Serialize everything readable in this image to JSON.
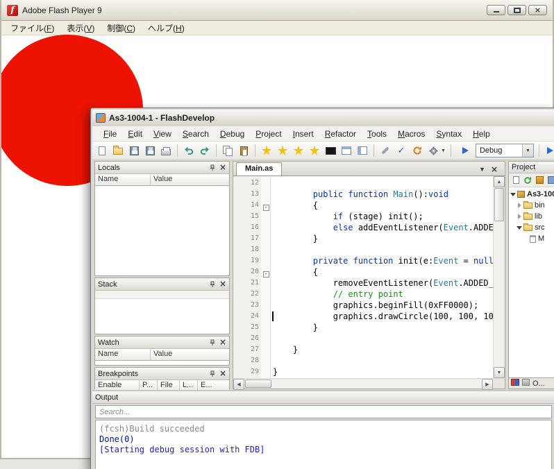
{
  "flash_player": {
    "title": "Adobe Flash Player 9",
    "menus": [
      "ファイル(F)",
      "表示(V)",
      "制御(C)",
      "ヘルプ(H)"
    ],
    "stage_circle_color": "#ED1300"
  },
  "fd": {
    "title": "As3-1004-1 - FlashDevelop",
    "menus": [
      "File",
      "Edit",
      "View",
      "Search",
      "Debug",
      "Project",
      "Insert",
      "Refactor",
      "Tools",
      "Macros",
      "Syntax",
      "Help"
    ],
    "toolbar": {
      "config_selected": "Debug"
    },
    "locals": {
      "title": "Locals",
      "columns": [
        "Name",
        "Value"
      ]
    },
    "stack": {
      "title": "Stack"
    },
    "watch": {
      "title": "Watch",
      "columns": [
        "Name",
        "Value"
      ]
    },
    "breakpoints": {
      "title": "Breakpoints",
      "columns": [
        "Enable",
        "P...",
        "File",
        "L...",
        "E..."
      ]
    },
    "editor": {
      "tab": "Main.as",
      "token_colors": {
        "k": "#0431c8",
        "t": "#1a7e99",
        "c": "#109310",
        "p": "#000000"
      },
      "lines": [
        {
          "n": 12,
          "segs": []
        },
        {
          "n": 13,
          "segs": [
            [
              "        ",
              "p"
            ],
            [
              "public",
              "k"
            ],
            [
              " ",
              "p"
            ],
            [
              "function",
              "k"
            ],
            [
              " ",
              "p"
            ],
            [
              "Main",
              "t"
            ],
            [
              "():",
              "p"
            ],
            [
              "void",
              "k"
            ]
          ]
        },
        {
          "n": 14,
          "fold": true,
          "segs": [
            [
              "        {",
              "p"
            ]
          ]
        },
        {
          "n": 15,
          "segs": [
            [
              "            ",
              "p"
            ],
            [
              "if",
              "k"
            ],
            [
              " (stage) init();",
              "p"
            ]
          ]
        },
        {
          "n": 16,
          "segs": [
            [
              "            ",
              "p"
            ],
            [
              "else",
              "k"
            ],
            [
              " addEventListener(",
              "p"
            ],
            [
              "Event",
              "t"
            ],
            [
              ".ADDE",
              "p"
            ]
          ]
        },
        {
          "n": 17,
          "segs": [
            [
              "        }",
              "p"
            ]
          ]
        },
        {
          "n": 18,
          "segs": []
        },
        {
          "n": 19,
          "segs": [
            [
              "        ",
              "p"
            ],
            [
              "private",
              "k"
            ],
            [
              " ",
              "p"
            ],
            [
              "function",
              "k"
            ],
            [
              " init(e:",
              "p"
            ],
            [
              "Event",
              "t"
            ],
            [
              " = ",
              "p"
            ],
            [
              "null",
              "k"
            ]
          ]
        },
        {
          "n": 20,
          "fold": true,
          "segs": [
            [
              "        {",
              "p"
            ]
          ]
        },
        {
          "n": 21,
          "segs": [
            [
              "            removeEventListener(",
              "p"
            ],
            [
              "Event",
              "t"
            ],
            [
              ".ADDED_",
              "p"
            ]
          ]
        },
        {
          "n": 22,
          "segs": [
            [
              "            ",
              "p"
            ],
            [
              "// entry point",
              "c"
            ]
          ]
        },
        {
          "n": 23,
          "segs": [
            [
              "            graphics.beginFill(0xFF0000);",
              "p"
            ]
          ]
        },
        {
          "n": 24,
          "caret": true,
          "segs": [
            [
              "            graphics.drawCircle(100, 100, 10",
              "p"
            ]
          ]
        },
        {
          "n": 25,
          "segs": [
            [
              "        }",
              "p"
            ]
          ]
        },
        {
          "n": 26,
          "segs": []
        },
        {
          "n": 27,
          "segs": [
            [
              "    }",
              "p"
            ]
          ]
        },
        {
          "n": 28,
          "segs": []
        },
        {
          "n": 29,
          "segs": [
            [
              "}",
              "p"
            ]
          ]
        }
      ]
    },
    "project": {
      "title": "Project",
      "tree": [
        {
          "label": "As3-100",
          "icon": "package",
          "expander": "open",
          "indent": 0,
          "bold": true
        },
        {
          "label": "bin",
          "icon": "folder",
          "expander": "closed",
          "indent": 1
        },
        {
          "label": "lib",
          "icon": "folder",
          "expander": "closed",
          "indent": 1
        },
        {
          "label": "src",
          "icon": "folder",
          "expander": "open",
          "indent": 1
        },
        {
          "label": "M",
          "icon": "file",
          "expander": "none",
          "indent": 2
        }
      ],
      "bottom_tab_label": "O..."
    },
    "output": {
      "title": "Output",
      "search_placeholder": "Search...",
      "lines": [
        {
          "text": "(fcsh)Build succeeded",
          "color": "#8a8a8a"
        },
        {
          "text": "Done(0)",
          "color": "#00117f"
        },
        {
          "text": "[Starting debug session with FDB]",
          "color": "#2020cc"
        }
      ]
    }
  }
}
